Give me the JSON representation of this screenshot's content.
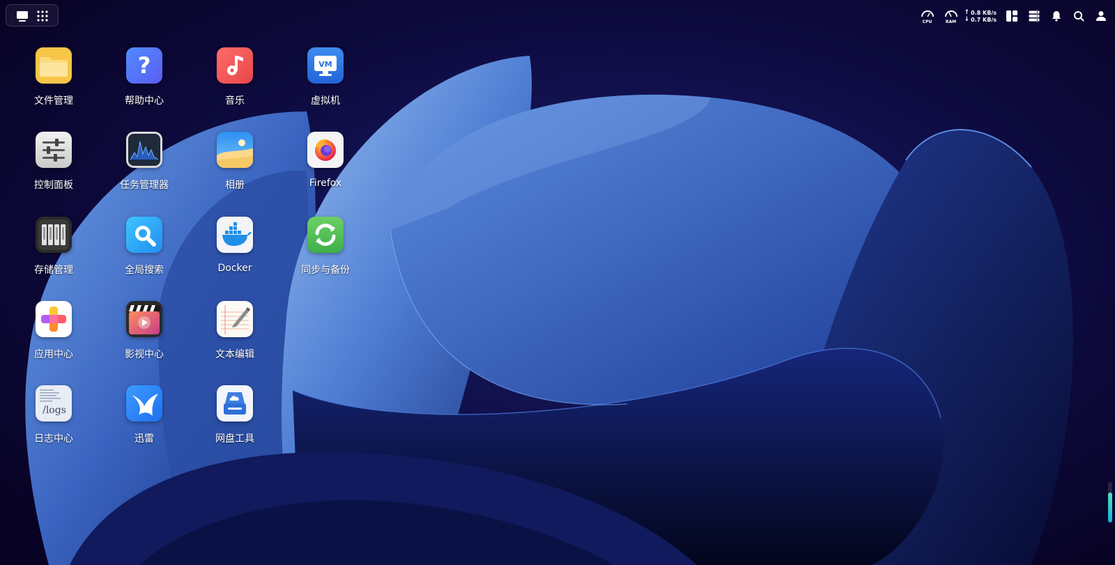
{
  "desktop": {
    "apps": [
      {
        "label": "文件管理",
        "icon": "folder-icon"
      },
      {
        "label": "帮助中心",
        "icon": "help-question-icon"
      },
      {
        "label": "音乐",
        "icon": "music-note-icon"
      },
      {
        "label": "虚拟机",
        "icon": "vm-monitor-icon",
        "badge": "VM"
      },
      {
        "label": "控制面板",
        "icon": "sliders-icon"
      },
      {
        "label": "任务管理器",
        "icon": "activity-monitor-icon"
      },
      {
        "label": "相册",
        "icon": "photo-landscape-icon"
      },
      {
        "label": "Firefox",
        "icon": "firefox-icon"
      },
      {
        "label": "存储管理",
        "icon": "storage-drives-icon"
      },
      {
        "label": "全局搜索",
        "icon": "search-magnifier-icon"
      },
      {
        "label": "Docker",
        "icon": "docker-whale-icon"
      },
      {
        "label": "同步与备份",
        "icon": "sync-arrows-icon"
      },
      {
        "label": "应用中心",
        "icon": "app-store-icon"
      },
      {
        "label": "影视中心",
        "icon": "video-clapper-icon"
      },
      {
        "label": "文本编辑",
        "icon": "text-notepad-icon"
      },
      {
        "label": "日志中心",
        "icon": "logs-file-icon",
        "badge": "/logs"
      },
      {
        "label": "迅雷",
        "icon": "thunder-bird-icon"
      },
      {
        "label": "网盘工具",
        "icon": "cloud-drive-icon"
      }
    ]
  },
  "tray": {
    "cpu_label": "CPU",
    "ram_label": "RAM",
    "upload_speed": "0.8 KB/s",
    "download_speed": "0.7 KB/s",
    "up_arrow": "↑",
    "down_arrow": "↓"
  },
  "storage_meter": {
    "fill_fraction": 0.75
  },
  "colors": {
    "background": "#0c0630",
    "accent_blue": "#3f7fe0",
    "meter_green": "#2dd4bf"
  }
}
